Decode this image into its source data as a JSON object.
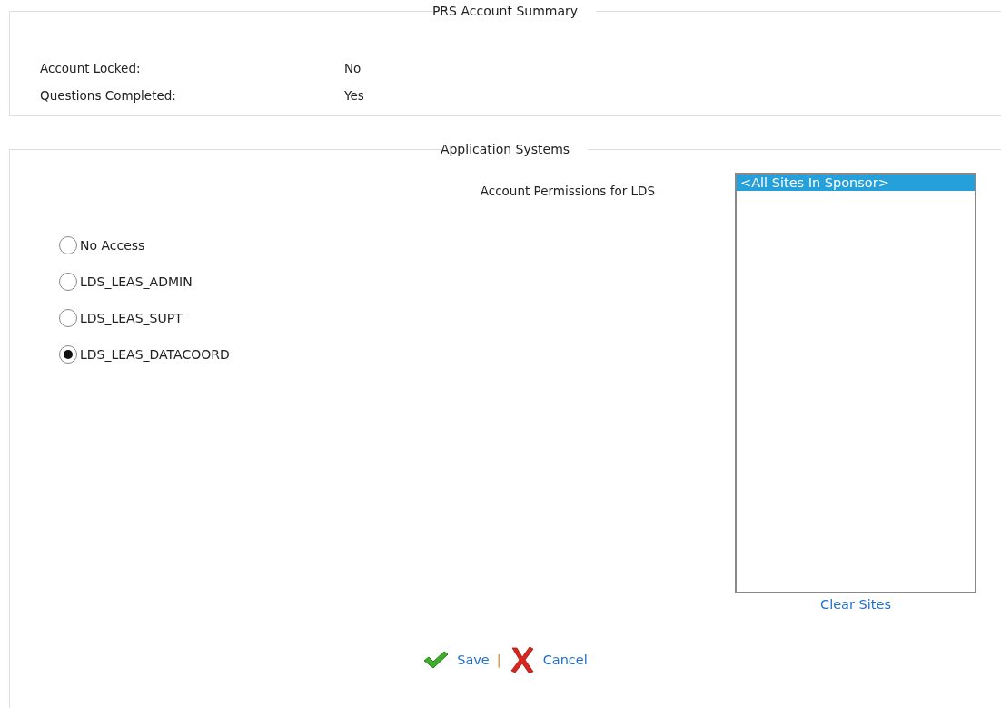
{
  "account_summary": {
    "legend": "PRS Account Summary",
    "fields": [
      {
        "label": "Account Locked:",
        "value": "No"
      },
      {
        "label": "Questions Completed:",
        "value": "Yes"
      }
    ]
  },
  "application_systems": {
    "legend": "Application Systems",
    "permissions_title": "Account Permissions for LDS",
    "roles": [
      {
        "label": "No Access",
        "selected": false
      },
      {
        "label": "LDS_LEAS_ADMIN",
        "selected": false
      },
      {
        "label": "LDS_LEAS_SUPT",
        "selected": false
      },
      {
        "label": "LDS_LEAS_DATACOORD",
        "selected": true
      }
    ],
    "sites": [
      {
        "label": "<All Sites In Sponsor>",
        "selected": true
      }
    ],
    "clear_sites": "Clear Sites",
    "save": "Save",
    "separator": "|",
    "cancel": "Cancel"
  }
}
